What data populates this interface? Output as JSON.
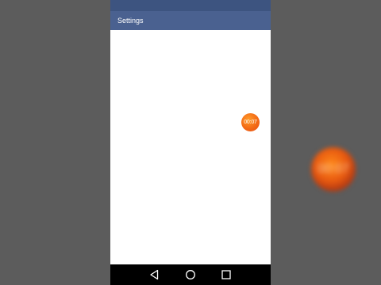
{
  "app": {
    "title": "Settings"
  },
  "floating_timer": {
    "text": "00:07",
    "color": "#f36a16"
  },
  "background_overlay": {
    "text": "00:07"
  },
  "navbar": {
    "back_icon": "back-triangle",
    "home_icon": "home-circle",
    "recents_icon": "recents-square"
  },
  "colors": {
    "statusbar": "#3d5480",
    "appbar": "#4a6190",
    "content": "#ffffff",
    "navbar": "#000000",
    "backdrop": "#5c5c5c"
  }
}
